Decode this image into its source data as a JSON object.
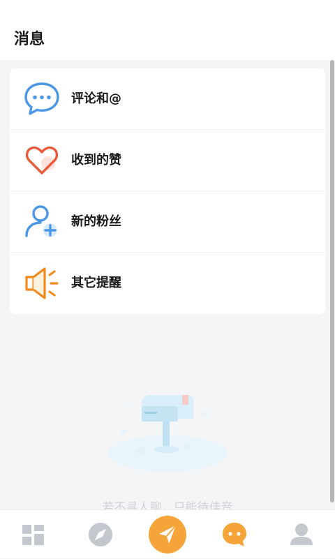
{
  "header": {
    "title": "消息"
  },
  "menu": {
    "items": [
      {
        "label": "评论和@",
        "icon": "comment-bubble-icon",
        "color": "#4a97e6"
      },
      {
        "label": "收到的赞",
        "icon": "heart-icon",
        "color": "#e85a3a"
      },
      {
        "label": "新的粉丝",
        "icon": "add-user-icon",
        "color": "#4a97e6"
      },
      {
        "label": "其它提醒",
        "icon": "speaker-icon",
        "color": "#f08a1c"
      }
    ]
  },
  "empty_state": {
    "text": "若不寻人聊，只能待佳音",
    "icon": "mailbox-illustration"
  },
  "tabbar": {
    "tabs": [
      {
        "icon": "dashboard-grid-icon"
      },
      {
        "icon": "compass-icon"
      },
      {
        "icon": "send-arrow-icon",
        "accent": "#f5a43a"
      },
      {
        "icon": "chat-bubble-icon",
        "active": true,
        "accent": "#f5a43a"
      },
      {
        "icon": "profile-icon"
      }
    ]
  }
}
